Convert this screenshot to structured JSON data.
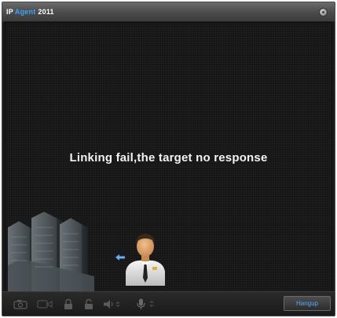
{
  "window": {
    "title": {
      "ip": "IP",
      "agent": "Agent",
      "year": "2011"
    }
  },
  "screen": {
    "status_message": "Linking fail,the target no response"
  },
  "toolbar": {
    "hangup_label": "Hangup"
  },
  "icons": [
    "close-icon",
    "camera-icon",
    "video-icon",
    "lock-icon",
    "unlock-icon",
    "speaker-icon",
    "microphone-icon",
    "buildings-icon",
    "arrow-left-icon",
    "agent-person-icon"
  ],
  "colors": {
    "agent_blue": "#3ea0ff",
    "screen_bg": "#161616",
    "status_text": "#f2f2f2",
    "hangup_text": "#5aa8ff"
  }
}
